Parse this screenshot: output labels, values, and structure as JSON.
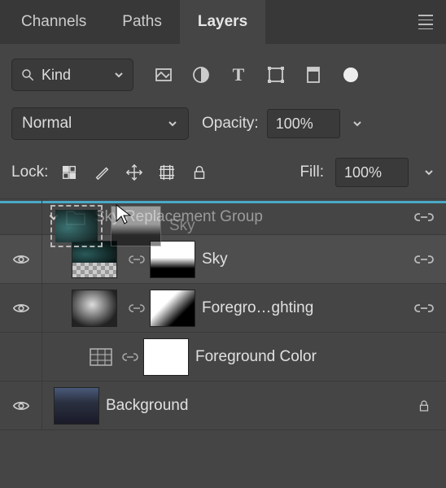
{
  "tabs": {
    "channels": "Channels",
    "paths": "Paths",
    "layers": "Layers",
    "active": "layers"
  },
  "filter": {
    "kind_label": "Kind",
    "type_icons": [
      "image-filter-icon",
      "adjustment-filter-icon",
      "type-filter-icon",
      "shape-filter-icon",
      "smartobject-filter-icon"
    ]
  },
  "blend": {
    "mode": "Normal",
    "opacity_label": "Opacity:",
    "opacity_value": "100%"
  },
  "lock": {
    "label": "Lock:",
    "icons": [
      "lock-pixels-icon",
      "lock-brush-icon",
      "lock-position-icon",
      "lock-artboard-icon",
      "lock-all-icon"
    ],
    "fill_label": "Fill:",
    "fill_value": "100%"
  },
  "drag": {
    "ghost_label": "Sky",
    "group_ghost_left": "Sky Replacement Group"
  },
  "layers": [
    {
      "type": "group",
      "name": "Sky Replacement Group",
      "visible": false,
      "expanded": true,
      "linked": true,
      "indent": 0
    },
    {
      "type": "layer",
      "name": "Sky",
      "visible": true,
      "selected": true,
      "thumb": "img1",
      "mask": "grad",
      "linked": true,
      "indent": 1
    },
    {
      "type": "layer",
      "name": "Foregro…ghting",
      "visible": true,
      "thumb": "img2",
      "mask": "grad2",
      "linked": true,
      "indent": 1
    },
    {
      "type": "adjustment",
      "name": "Foreground Color",
      "visible": true,
      "mask": "white",
      "indent": 2
    },
    {
      "type": "background",
      "name": "Background",
      "visible": true,
      "thumb": "bg",
      "locked": true,
      "indent": 0
    }
  ]
}
